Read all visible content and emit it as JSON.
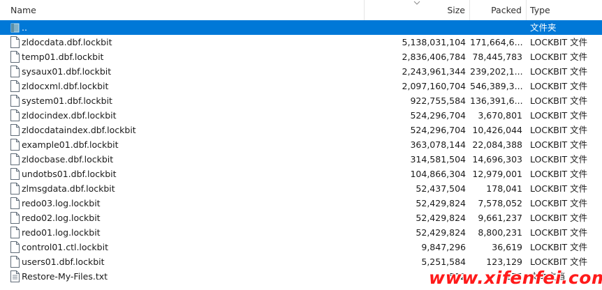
{
  "columns": {
    "name": "Name",
    "size": "Size",
    "packed": "Packed",
    "type": "Type"
  },
  "sort": {
    "column": "size",
    "direction": "descending"
  },
  "accent_color": "#0078d7",
  "parent_row": {
    "name": "..",
    "type": "文件夹",
    "icon": "parent-folder-icon"
  },
  "files": [
    {
      "name": "zldocdata.dbf.lockbit",
      "size": "5,138,031,104",
      "packed": "171,664,6...",
      "type": "LOCKBIT 文件",
      "icon": "file-icon"
    },
    {
      "name": "temp01.dbf.lockbit",
      "size": "2,836,406,784",
      "packed": "78,445,783",
      "type": "LOCKBIT 文件",
      "icon": "file-icon"
    },
    {
      "name": "sysaux01.dbf.lockbit",
      "size": "2,243,961,344",
      "packed": "239,202,1...",
      "type": "LOCKBIT 文件",
      "icon": "file-icon"
    },
    {
      "name": "zldocxml.dbf.lockbit",
      "size": "2,097,160,704",
      "packed": "546,389,3...",
      "type": "LOCKBIT 文件",
      "icon": "file-icon"
    },
    {
      "name": "system01.dbf.lockbit",
      "size": "922,755,584",
      "packed": "136,391,6...",
      "type": "LOCKBIT 文件",
      "icon": "file-icon"
    },
    {
      "name": "zldocindex.dbf.lockbit",
      "size": "524,296,704",
      "packed": "3,670,801",
      "type": "LOCKBIT 文件",
      "icon": "file-icon"
    },
    {
      "name": "zldocdataindex.dbf.lockbit",
      "size": "524,296,704",
      "packed": "10,426,044",
      "type": "LOCKBIT 文件",
      "icon": "file-icon"
    },
    {
      "name": "example01.dbf.lockbit",
      "size": "363,078,144",
      "packed": "22,084,388",
      "type": "LOCKBIT 文件",
      "icon": "file-icon"
    },
    {
      "name": "zldocbase.dbf.lockbit",
      "size": "314,581,504",
      "packed": "14,696,303",
      "type": "LOCKBIT 文件",
      "icon": "file-icon"
    },
    {
      "name": "undotbs01.dbf.lockbit",
      "size": "104,866,304",
      "packed": "12,979,001",
      "type": "LOCKBIT 文件",
      "icon": "file-icon"
    },
    {
      "name": "zlmsgdata.dbf.lockbit",
      "size": "52,437,504",
      "packed": "178,041",
      "type": "LOCKBIT 文件",
      "icon": "file-icon"
    },
    {
      "name": "redo03.log.lockbit",
      "size": "52,429,824",
      "packed": "7,578,052",
      "type": "LOCKBIT 文件",
      "icon": "file-icon"
    },
    {
      "name": "redo02.log.lockbit",
      "size": "52,429,824",
      "packed": "9,661,237",
      "type": "LOCKBIT 文件",
      "icon": "file-icon"
    },
    {
      "name": "redo01.log.lockbit",
      "size": "52,429,824",
      "packed": "8,800,231",
      "type": "LOCKBIT 文件",
      "icon": "file-icon"
    },
    {
      "name": "control01.ctl.lockbit",
      "size": "9,847,296",
      "packed": "36,619",
      "type": "LOCKBIT 文件",
      "icon": "file-icon"
    },
    {
      "name": "users01.dbf.lockbit",
      "size": "5,251,584",
      "packed": "123,129",
      "type": "LOCKBIT 文件",
      "icon": "file-icon"
    },
    {
      "name": "Restore-My-Files.txt",
      "size": "512",
      "packed": "275",
      "type": "文本文档",
      "icon": "text-file-icon"
    }
  ],
  "watermark": "www.xifenfei.com"
}
